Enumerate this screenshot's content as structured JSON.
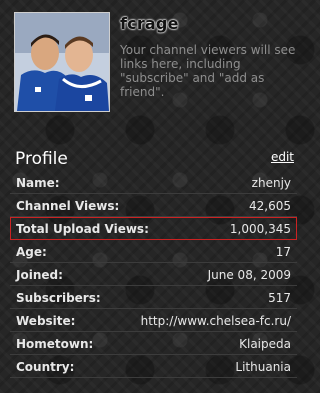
{
  "channel": {
    "name": "fcrage",
    "info_text": "Your channel viewers will see links here, including \"subscribe\" and \"add as friend\"."
  },
  "profile": {
    "title": "Profile",
    "edit_label": "edit",
    "rows": [
      {
        "label": "Name:",
        "value": "zhenjy"
      },
      {
        "label": "Channel Views:",
        "value": "42,605"
      },
      {
        "label": "Total Upload Views:",
        "value": "1,000,345"
      },
      {
        "label": "Age:",
        "value": "17"
      },
      {
        "label": "Joined:",
        "value": "June 08, 2009"
      },
      {
        "label": "Subscribers:",
        "value": "517"
      },
      {
        "label": "Website:",
        "value": "http://www.chelsea-fc.ru/"
      },
      {
        "label": "Hometown:",
        "value": "Klaipeda"
      },
      {
        "label": "Country:",
        "value": "Lithuania"
      }
    ]
  },
  "colors": {
    "background": "#262626",
    "highlight_border": "#cc2222",
    "jersey_blue": "#1f4fa8"
  }
}
